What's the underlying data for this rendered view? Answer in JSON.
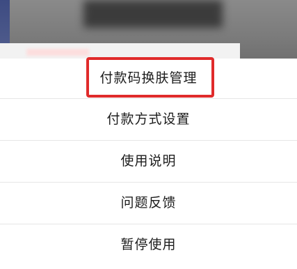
{
  "action_sheet": {
    "items": [
      {
        "label": "付款码换肤管理"
      },
      {
        "label": "付款方式设置"
      },
      {
        "label": "使用说明"
      },
      {
        "label": "问题反馈"
      },
      {
        "label": "暂停使用"
      }
    ]
  },
  "colors": {
    "highlight": "#e02b2b",
    "divider": "#e6e6e6",
    "text": "#1c1c1c"
  }
}
